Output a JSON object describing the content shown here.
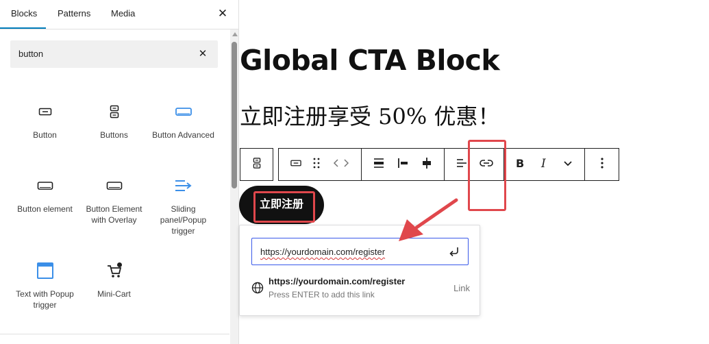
{
  "inserter": {
    "tabs": [
      {
        "label": "Blocks",
        "active": true
      },
      {
        "label": "Patterns",
        "active": false
      },
      {
        "label": "Media",
        "active": false
      }
    ],
    "close_icon": "close-icon",
    "search": {
      "value": "button",
      "clear_icon": "close-icon"
    },
    "blocks": [
      {
        "label": "Button",
        "icon": "button-icon"
      },
      {
        "label": "Buttons",
        "icon": "buttons-icon"
      },
      {
        "label": "Button Advanced",
        "icon": "button-advanced-icon"
      },
      {
        "label": "Button element",
        "icon": "button-element-icon"
      },
      {
        "label": "Button Element with Overlay",
        "icon": "button-overlay-icon"
      },
      {
        "label": "Sliding panel/Popup trigger",
        "icon": "sliding-panel-icon"
      },
      {
        "label": "Text with Popup trigger",
        "icon": "popup-window-icon"
      },
      {
        "label": "Mini-Cart",
        "icon": "cart-icon"
      }
    ]
  },
  "editor": {
    "title": "Global CTA Block",
    "subtitle": "立即注册享受 50% 优惠！",
    "button_text": "立即注册",
    "toolbar": {
      "parent_icon": "buttons-icon",
      "items": [
        "button-icon",
        "drag-handle-icon",
        "move-arrows-icon",
        "align-justify-icon",
        "align-left-icon",
        "align-center-icon",
        "text-align-icon",
        "link-icon",
        "bold-icon",
        "italic-icon",
        "chevron-down-icon",
        "more-options-icon"
      ]
    },
    "link_popover": {
      "url_value": "https://yourdomain.com/register",
      "submit_icon": "enter-return-icon",
      "suggestion_title": "https://yourdomain.com/register",
      "suggestion_hint": "Press ENTER to add this link",
      "suggestion_type": "Link",
      "suggestion_icon": "globe-icon"
    }
  },
  "colors": {
    "accent_blue": "#007cba",
    "icon_blue": "#3b8fe8",
    "annotation_red": "#e0474c",
    "button_bg": "#111111"
  }
}
